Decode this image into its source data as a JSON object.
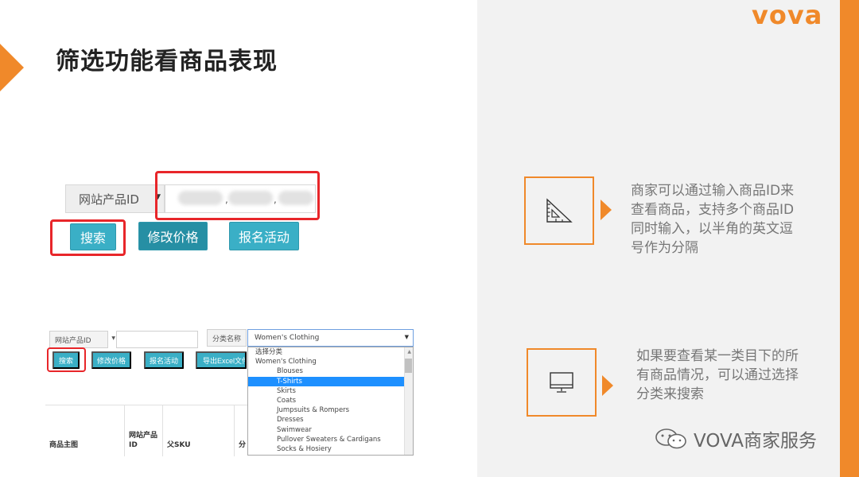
{
  "slide": {
    "title": "筛选功能看商品表现",
    "logo": "vova",
    "watermark": "VOVA商家服务",
    "accent_color": "#F0892A",
    "highlight_color": "#E8262A",
    "button_color": "#3AAFC6"
  },
  "top_ui": {
    "field_label": "网站产品ID",
    "search_button": "搜索",
    "modify_price_button": "修改价格",
    "register_activity_button": "报名活动"
  },
  "bottom_ui": {
    "field_label": "网站产品ID",
    "category_label": "分类名称",
    "category_selected": "Women's Clothing",
    "search_button": "搜索",
    "modify_price_button": "修改价格",
    "register_activity_button": "报名活动",
    "export_button": "导出Excel文件",
    "dropdown_options": [
      {
        "label": "选择分类",
        "indent": 0,
        "selected": false
      },
      {
        "label": "Women's Clothing",
        "indent": 0,
        "selected": false
      },
      {
        "label": "Blouses",
        "indent": 1,
        "selected": false
      },
      {
        "label": "T-Shirts",
        "indent": 1,
        "selected": true
      },
      {
        "label": "Skirts",
        "indent": 1,
        "selected": false
      },
      {
        "label": "Coats",
        "indent": 1,
        "selected": false
      },
      {
        "label": "Jumpsuits & Rompers",
        "indent": 1,
        "selected": false
      },
      {
        "label": "Dresses",
        "indent": 1,
        "selected": false
      },
      {
        "label": "Swimwear",
        "indent": 1,
        "selected": false
      },
      {
        "label": "Pullover Sweaters & Cardigans",
        "indent": 1,
        "selected": false
      },
      {
        "label": "Socks & Hosiery",
        "indent": 1,
        "selected": false
      }
    ],
    "table_headers": [
      "商品主图",
      "网站产品ID",
      "父SKU",
      "分"
    ]
  },
  "panel": {
    "desc1": "商家可以通过输入商品ID来查看商品，支持多个商品ID同时输入，以半角的英文逗号作为分隔",
    "desc2": "如果要查看某一类目下的所有商品情况，可以通过选择分类来搜索",
    "icon1": "ruler-triangle-icon",
    "icon2": "monitor-icon"
  }
}
